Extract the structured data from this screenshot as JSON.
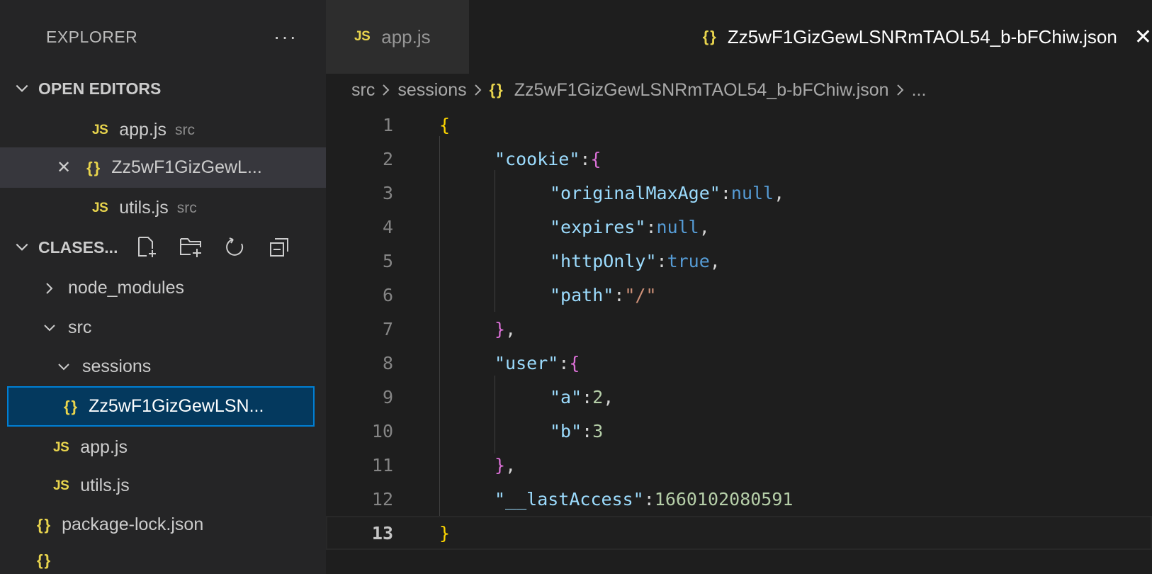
{
  "sidebar": {
    "title": "EXPLORER",
    "more": "···",
    "open_editors": {
      "label": "OPEN EDITORS",
      "items": [
        {
          "badge": "JS",
          "name": "app.js",
          "dir": "src"
        },
        {
          "badge": "{}",
          "name": "Zz5wF1GizGewL...",
          "close": "✕"
        },
        {
          "badge": "JS",
          "name": "utils.js",
          "dir": "src"
        }
      ]
    },
    "workspace": {
      "label": "CLASES...",
      "tree": [
        {
          "name": "node_modules"
        },
        {
          "name": "src"
        },
        {
          "name": "sessions"
        },
        {
          "badge": "{}",
          "name": "Zz5wF1GizGewLSN..."
        },
        {
          "badge": "JS",
          "name": "app.js"
        },
        {
          "badge": "JS",
          "name": "utils.js"
        },
        {
          "badge": "{}",
          "name": "package-lock.json"
        }
      ]
    }
  },
  "tabs": [
    {
      "badge": "JS",
      "label": "app.js"
    },
    {
      "badge": "{}",
      "label": "Zz5wF1GizGewLSNRmTAOL54_b-bFChiw.json",
      "close": "✕"
    }
  ],
  "breadcrumb": {
    "parts": [
      "src",
      "sessions"
    ],
    "badge": "{}",
    "file": "Zz5wF1GizGewLSNRmTAOL54_b-bFChiw.json",
    "trail": "..."
  },
  "code": {
    "line_numbers": [
      "1",
      "2",
      "3",
      "4",
      "5",
      "6",
      "7",
      "8",
      "9",
      "10",
      "11",
      "12",
      "13"
    ],
    "lines": {
      "l1": {
        "open": "{"
      },
      "l2": {
        "key": "\"cookie\"",
        "colon": ":",
        "open": "{"
      },
      "l3": {
        "key": "\"originalMaxAge\"",
        "colon": ":",
        "val": "null",
        "comma": ","
      },
      "l4": {
        "key": "\"expires\"",
        "colon": ":",
        "val": "null",
        "comma": ","
      },
      "l5": {
        "key": "\"httpOnly\"",
        "colon": ":",
        "val": "true",
        "comma": ","
      },
      "l6": {
        "key": "\"path\"",
        "colon": ":",
        "val": "\"/\""
      },
      "l7": {
        "close": "}",
        "comma": ","
      },
      "l8": {
        "key": "\"user\"",
        "colon": ":",
        "open": "{"
      },
      "l9": {
        "key": "\"a\"",
        "colon": ":",
        "val": "2",
        "comma": ","
      },
      "l10": {
        "key": "\"b\"",
        "colon": ":",
        "val": "3"
      },
      "l11": {
        "close": "}",
        "comma": ","
      },
      "l12": {
        "key": "\"__lastAccess\"",
        "colon": ":",
        "val": "1660102080591"
      },
      "l13": {
        "close": "}"
      }
    }
  }
}
